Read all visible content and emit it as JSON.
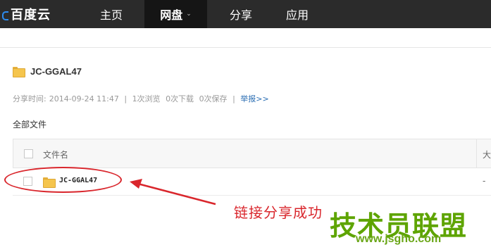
{
  "nav": {
    "logo": "百度云",
    "items": [
      "主页",
      "网盘",
      "分享",
      "应用"
    ],
    "active_chevron": "⌄"
  },
  "file": {
    "title": "JC-GGAL47",
    "share_time_label": "分享时间:",
    "share_time": "2014-09-24 11:47",
    "views": "1次浏览",
    "downloads": "0次下载",
    "saves": "0次保存",
    "report_link": "举报>>"
  },
  "section": {
    "label": "全部文件"
  },
  "table": {
    "columns": [
      "文件名",
      "大"
    ],
    "rows": [
      {
        "name": "JC-GGAL47",
        "size": "-"
      }
    ]
  },
  "annotation": {
    "text": "链接分享成功"
  },
  "watermark": {
    "text": "技术员联盟",
    "url": "www.jsgho.com"
  },
  "colors": {
    "topbar": "#2b2b2b",
    "annotation": "#d9262c",
    "link": "#2b6eb3",
    "watermark": "#5ea400"
  },
  "icons": [
    "logo-icon",
    "chevron-down-icon",
    "folder-icon",
    "checkbox-icon",
    "arrow-icon"
  ]
}
